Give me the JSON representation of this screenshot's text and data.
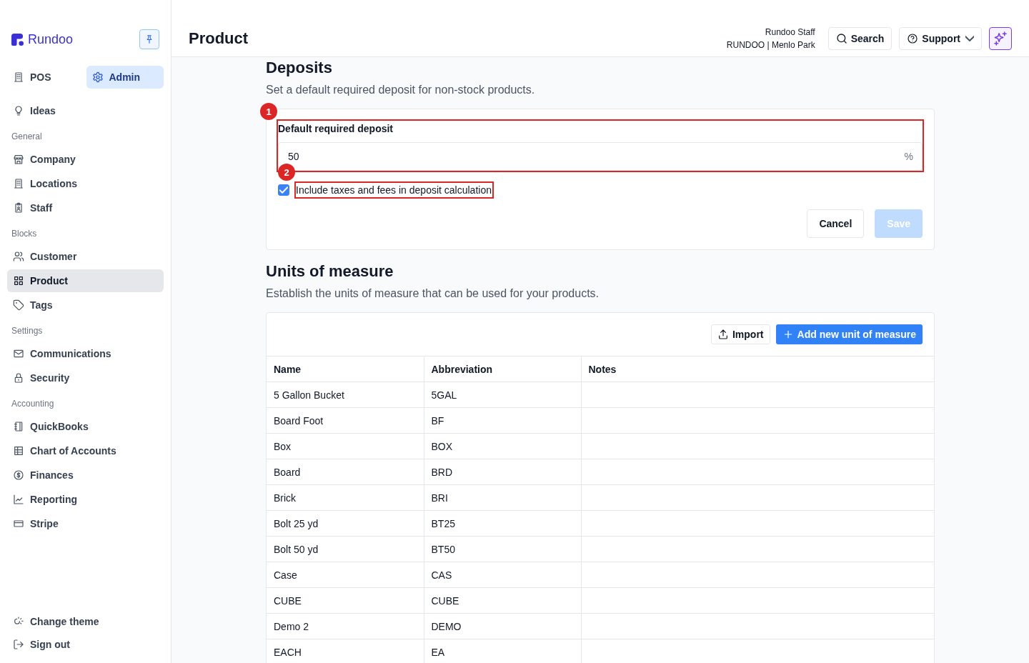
{
  "sidebar": {
    "logo": "Rundoo",
    "modes": [
      {
        "label": "POS",
        "selected": false
      },
      {
        "label": "Admin",
        "selected": true
      }
    ],
    "top_items": [
      {
        "label": "Ideas",
        "selected": false
      }
    ],
    "sections": [
      {
        "title": "General",
        "items": [
          {
            "label": "Company",
            "selected": false
          },
          {
            "label": "Locations",
            "selected": false
          },
          {
            "label": "Staff",
            "selected": false
          }
        ]
      },
      {
        "title": "Blocks",
        "items": [
          {
            "label": "Customer",
            "selected": false
          },
          {
            "label": "Product",
            "selected": true
          },
          {
            "label": "Tags",
            "selected": false
          }
        ]
      },
      {
        "title": "Settings",
        "items": [
          {
            "label": "Communications",
            "selected": false
          },
          {
            "label": "Security",
            "selected": false
          }
        ]
      },
      {
        "title": "Accounting",
        "items": [
          {
            "label": "QuickBooks",
            "selected": false
          },
          {
            "label": "Chart of Accounts",
            "selected": false
          },
          {
            "label": "Finances",
            "selected": false
          },
          {
            "label": "Reporting",
            "selected": false
          },
          {
            "label": "Stripe",
            "selected": false
          }
        ]
      }
    ],
    "bottom_items": [
      "Change theme",
      "Sign out"
    ]
  },
  "header": {
    "title": "Product",
    "user_name": "Rundoo Staff",
    "user_location": "RUNDOO | Menlo Park",
    "search_button": "Search",
    "support_button": "Support"
  },
  "deposits": {
    "title": "Deposits",
    "description": "Set a default required deposit for non-stock products.",
    "field": {
      "label": "Default required deposit",
      "value": "50",
      "suffix": "%",
      "annotation": "1"
    },
    "checkbox": {
      "label": "Include taxes and fees in deposit calculation",
      "checked": true,
      "annotation": "2"
    },
    "buttons": [
      {
        "label": "Cancel",
        "kind": "secondary",
        "disabled": false
      },
      {
        "label": "Save",
        "kind": "primary",
        "disabled": true
      }
    ]
  },
  "units": {
    "title": "Units of measure",
    "description": "Establish the units of measure that can be used for your products.",
    "actions": [
      {
        "label": "Import",
        "kind": "secondary"
      },
      {
        "label": "Add new unit of measure",
        "kind": "primary"
      }
    ],
    "table": {
      "columns": [
        "Name",
        "Abbreviation",
        "Notes"
      ],
      "rows": [
        {
          "name": "5 Gallon Bucket",
          "abbreviation": "5GAL"
        },
        {
          "name": "Board Foot",
          "abbreviation": "BF"
        },
        {
          "name": "Box",
          "abbreviation": "BOX"
        },
        {
          "name": "Board",
          "abbreviation": "BRD"
        },
        {
          "name": "Brick",
          "abbreviation": "BRI"
        },
        {
          "name": "Bolt 25 yd",
          "abbreviation": "BT25"
        },
        {
          "name": "Bolt 50 yd",
          "abbreviation": "BT50"
        },
        {
          "name": "Case",
          "abbreviation": "CAS"
        },
        {
          "name": "CUBE",
          "abbreviation": "CUBE"
        },
        {
          "name": "Demo 2",
          "abbreviation": "DEMO"
        },
        {
          "name": "EACH",
          "abbreviation": "EA"
        }
      ]
    }
  }
}
